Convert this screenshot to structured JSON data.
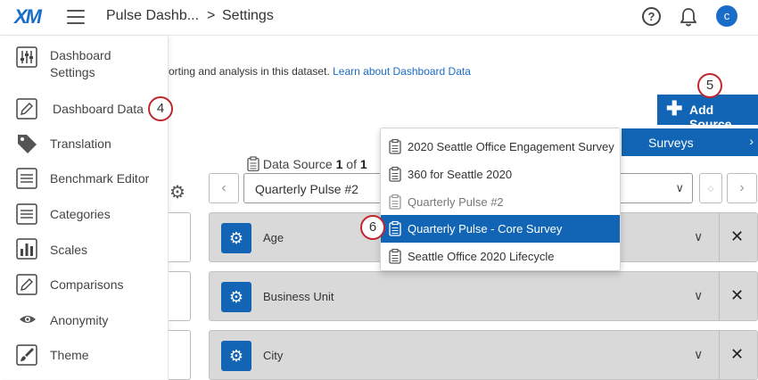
{
  "topbar": {
    "logo": "XM",
    "app_title": "Pulse Dashb...",
    "breadcrumb_sep": ">",
    "breadcrumb_current": "Settings",
    "help": "?",
    "avatar_initial": "c"
  },
  "sidebar": {
    "items": [
      {
        "label": "Dashboard\nSettings",
        "icon": "sliders-icon"
      },
      {
        "label": "Dashboard Data",
        "icon": "pencil-icon"
      },
      {
        "label": "Translation",
        "icon": "tag-icon"
      },
      {
        "label": "Benchmark Editor",
        "icon": "list-icon"
      },
      {
        "label": "Categories",
        "icon": "list-icon"
      },
      {
        "label": "Scales",
        "icon": "bar-chart-icon"
      },
      {
        "label": "Comparisons",
        "icon": "pencil-icon"
      },
      {
        "label": "Anonymity",
        "icon": "eye-icon"
      },
      {
        "label": "Theme",
        "icon": "brush-icon"
      }
    ]
  },
  "markers": {
    "m4": "4",
    "m5": "5",
    "m6": "6"
  },
  "main": {
    "description": "orting and analysis in this dataset.",
    "description_link": "Learn about Dashboard Data",
    "add_source_label": "Add Source",
    "surveys_label": "Surveys",
    "data_source_prefix": "Data Source",
    "data_source_index": "1",
    "data_source_of": "of",
    "data_source_total": "1",
    "selected_source": "Quarterly Pulse #2",
    "fields": [
      {
        "label": "Age"
      },
      {
        "label": "Business Unit"
      },
      {
        "label": "City"
      }
    ]
  },
  "survey_menu": {
    "items": [
      {
        "label": "2020 Seattle Office Engagement Survey",
        "state": "normal"
      },
      {
        "label": "360 for Seattle 2020",
        "state": "normal"
      },
      {
        "label": "Quarterly Pulse #2",
        "state": "disabled"
      },
      {
        "label": "Quarterly Pulse - Core Survey",
        "state": "selected"
      },
      {
        "label": "Seattle Office 2020 Lifecycle",
        "state": "normal"
      }
    ]
  },
  "colors": {
    "brand_blue": "#1165b4",
    "marker_red": "#c0272d",
    "row_gray": "#d9d9d9"
  }
}
